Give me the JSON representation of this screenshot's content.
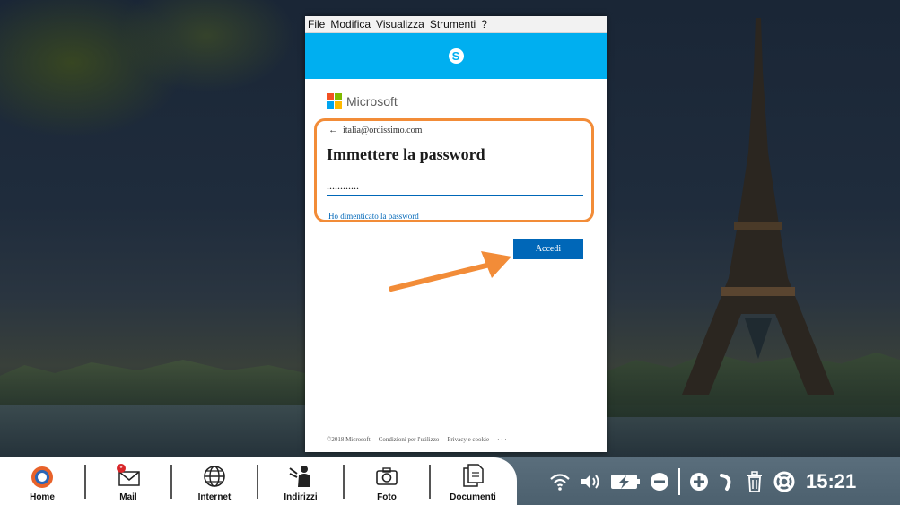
{
  "menubar": {
    "items": [
      "File",
      "Modifica",
      "Visualizza",
      "Strumenti",
      "?"
    ]
  },
  "skype": {
    "logo_letter": "S"
  },
  "login": {
    "brand": "Microsoft",
    "back_arrow": "←",
    "account_email": "italia@ordissimo.com",
    "title": "Immettere la password",
    "password_value": "............",
    "forgot_link": "Ho dimenticato la password",
    "submit_label": "Accedi",
    "footer": {
      "copyright": "©2018 Microsoft",
      "terms": "Condizioni per l'utilizzo",
      "privacy": "Privacy e cookie",
      "more": "· · ·"
    },
    "highlight_color": "#f28c38"
  },
  "dock": {
    "items": [
      {
        "label": "Home",
        "icon": "home-logo-icon"
      },
      {
        "label": "Mail",
        "icon": "mail-icon"
      },
      {
        "label": "Internet",
        "icon": "globe-icon"
      },
      {
        "label": "Indirizzi",
        "icon": "contacts-icon"
      },
      {
        "label": "Foto",
        "icon": "camera-icon"
      },
      {
        "label": "Documenti",
        "icon": "documents-icon"
      }
    ]
  },
  "tray": {
    "icons": [
      "wifi-icon",
      "volume-icon",
      "battery-charging-icon",
      "minus-zoom-icon",
      "plus-zoom-icon",
      "undo-icon",
      "trash-icon",
      "help-lifebuoy-icon"
    ],
    "clock": "15:21"
  },
  "colors": {
    "skype_blue": "#00aff0",
    "ms_blue": "#0067b8",
    "accent_orange": "#f28c38"
  }
}
